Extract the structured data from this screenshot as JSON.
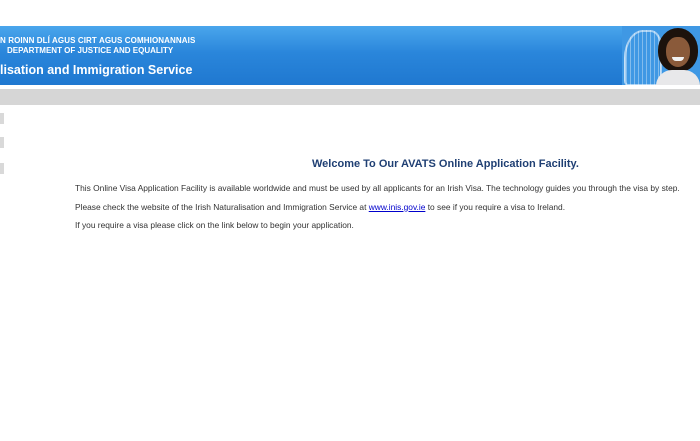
{
  "header": {
    "line1": "N ROINN DLÍ AGUS CIRT AGUS COMHIONANNAIS",
    "line2": "DEPARTMENT OF JUSTICE AND EQUALITY",
    "title": "lisation and Immigration Service",
    "brand_color": "#2a86db"
  },
  "main": {
    "welcome": "Welcome To Our AVATS Online Application Facility.",
    "para1": "This Online Visa Application Facility is available worldwide and must be used by all applicants for an Irish Visa. The technology guides you through the visa by step.",
    "para2_before": "Please check the website of the Irish Naturalisation and Immigration Service at ",
    "para2_link": "www.inis.gov.ie",
    "para2_after": " to see if you require a visa to Ireland.",
    "para3": "If you require a visa please click on the link below to begin your application."
  },
  "icons": {
    "banner_art": "harp-and-person-photo"
  }
}
